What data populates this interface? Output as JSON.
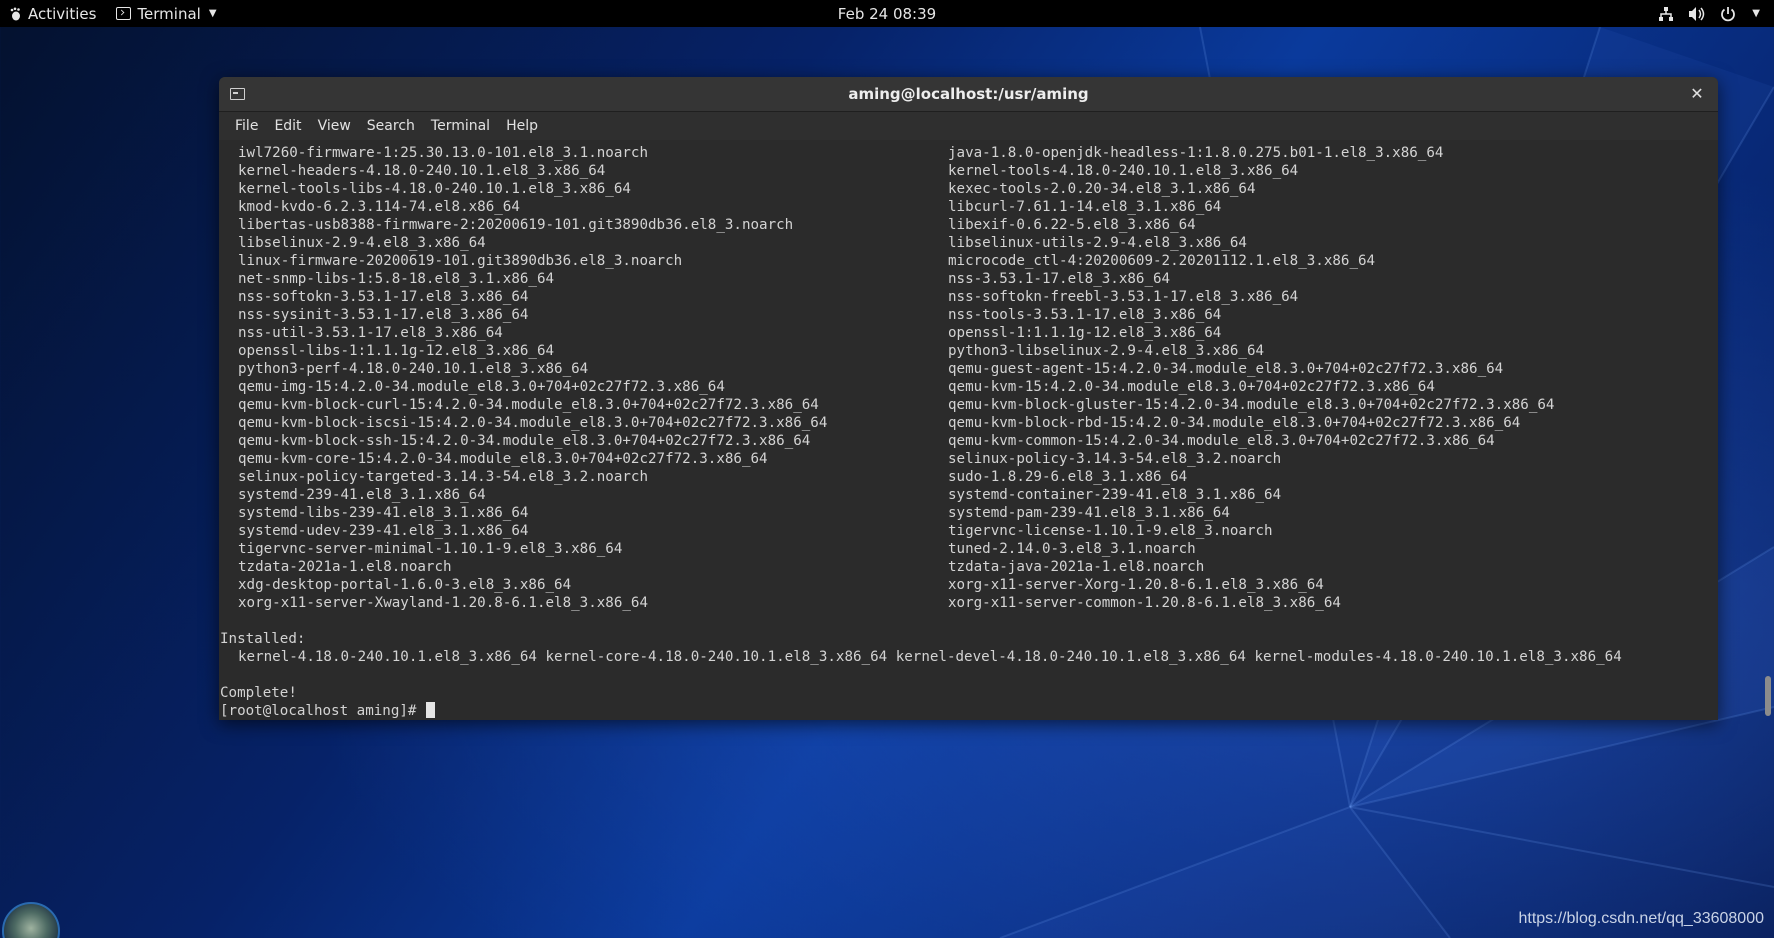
{
  "topbar": {
    "activities": "Activities",
    "app_name": "Terminal",
    "clock": "Feb 24  08:39"
  },
  "window": {
    "title": "aming@localhost:/usr/aming",
    "menu": [
      "File",
      "Edit",
      "View",
      "Search",
      "Terminal",
      "Help"
    ]
  },
  "terminal": {
    "packages": [
      [
        "iwl7260-firmware-1:25.30.13.0-101.el8_3.1.noarch",
        "java-1.8.0-openjdk-headless-1:1.8.0.275.b01-1.el8_3.x86_64"
      ],
      [
        "kernel-headers-4.18.0-240.10.1.el8_3.x86_64",
        "kernel-tools-4.18.0-240.10.1.el8_3.x86_64"
      ],
      [
        "kernel-tools-libs-4.18.0-240.10.1.el8_3.x86_64",
        "kexec-tools-2.0.20-34.el8_3.1.x86_64"
      ],
      [
        "kmod-kvdo-6.2.3.114-74.el8.x86_64",
        "libcurl-7.61.1-14.el8_3.1.x86_64"
      ],
      [
        "libertas-usb8388-firmware-2:20200619-101.git3890db36.el8_3.noarch",
        "libexif-0.6.22-5.el8_3.x86_64"
      ],
      [
        "libselinux-2.9-4.el8_3.x86_64",
        "libselinux-utils-2.9-4.el8_3.x86_64"
      ],
      [
        "linux-firmware-20200619-101.git3890db36.el8_3.noarch",
        "microcode_ctl-4:20200609-2.20201112.1.el8_3.x86_64"
      ],
      [
        "net-snmp-libs-1:5.8-18.el8_3.1.x86_64",
        "nss-3.53.1-17.el8_3.x86_64"
      ],
      [
        "nss-softokn-3.53.1-17.el8_3.x86_64",
        "nss-softokn-freebl-3.53.1-17.el8_3.x86_64"
      ],
      [
        "nss-sysinit-3.53.1-17.el8_3.x86_64",
        "nss-tools-3.53.1-17.el8_3.x86_64"
      ],
      [
        "nss-util-3.53.1-17.el8_3.x86_64",
        "openssl-1:1.1.1g-12.el8_3.x86_64"
      ],
      [
        "openssl-libs-1:1.1.1g-12.el8_3.x86_64",
        "python3-libselinux-2.9-4.el8_3.x86_64"
      ],
      [
        "python3-perf-4.18.0-240.10.1.el8_3.x86_64",
        "qemu-guest-agent-15:4.2.0-34.module_el8.3.0+704+02c27f72.3.x86_64"
      ],
      [
        "qemu-img-15:4.2.0-34.module_el8.3.0+704+02c27f72.3.x86_64",
        "qemu-kvm-15:4.2.0-34.module_el8.3.0+704+02c27f72.3.x86_64"
      ],
      [
        "qemu-kvm-block-curl-15:4.2.0-34.module_el8.3.0+704+02c27f72.3.x86_64",
        "qemu-kvm-block-gluster-15:4.2.0-34.module_el8.3.0+704+02c27f72.3.x86_64"
      ],
      [
        "qemu-kvm-block-iscsi-15:4.2.0-34.module_el8.3.0+704+02c27f72.3.x86_64",
        "qemu-kvm-block-rbd-15:4.2.0-34.module_el8.3.0+704+02c27f72.3.x86_64"
      ],
      [
        "qemu-kvm-block-ssh-15:4.2.0-34.module_el8.3.0+704+02c27f72.3.x86_64",
        "qemu-kvm-common-15:4.2.0-34.module_el8.3.0+704+02c27f72.3.x86_64"
      ],
      [
        "qemu-kvm-core-15:4.2.0-34.module_el8.3.0+704+02c27f72.3.x86_64",
        "selinux-policy-3.14.3-54.el8_3.2.noarch"
      ],
      [
        "selinux-policy-targeted-3.14.3-54.el8_3.2.noarch",
        "sudo-1.8.29-6.el8_3.1.x86_64"
      ],
      [
        "systemd-239-41.el8_3.1.x86_64",
        "systemd-container-239-41.el8_3.1.x86_64"
      ],
      [
        "systemd-libs-239-41.el8_3.1.x86_64",
        "systemd-pam-239-41.el8_3.1.x86_64"
      ],
      [
        "systemd-udev-239-41.el8_3.1.x86_64",
        "tigervnc-license-1.10.1-9.el8_3.noarch"
      ],
      [
        "tigervnc-server-minimal-1.10.1-9.el8_3.x86_64",
        "tuned-2.14.0-3.el8_3.1.noarch"
      ],
      [
        "tzdata-2021a-1.el8.noarch",
        "tzdata-java-2021a-1.el8.noarch"
      ],
      [
        "xdg-desktop-portal-1.6.0-3.el8_3.x86_64",
        "xorg-x11-server-Xorg-1.20.8-6.1.el8_3.x86_64"
      ],
      [
        "xorg-x11-server-Xwayland-1.20.8-6.1.el8_3.x86_64",
        "xorg-x11-server-common-1.20.8-6.1.el8_3.x86_64"
      ]
    ],
    "installed_header": "Installed:",
    "installed_line": "kernel-4.18.0-240.10.1.el8_3.x86_64 kernel-core-4.18.0-240.10.1.el8_3.x86_64 kernel-devel-4.18.0-240.10.1.el8_3.x86_64 kernel-modules-4.18.0-240.10.1.el8_3.x86_64",
    "complete": "Complete!",
    "prompt": "[root@localhost aming]# "
  },
  "watermark": "https://blog.csdn.net/qq_33608000",
  "icons": {
    "activities": "gnome-foot-icon",
    "network": "network-icon",
    "volume": "volume-icon",
    "power": "power-icon"
  }
}
